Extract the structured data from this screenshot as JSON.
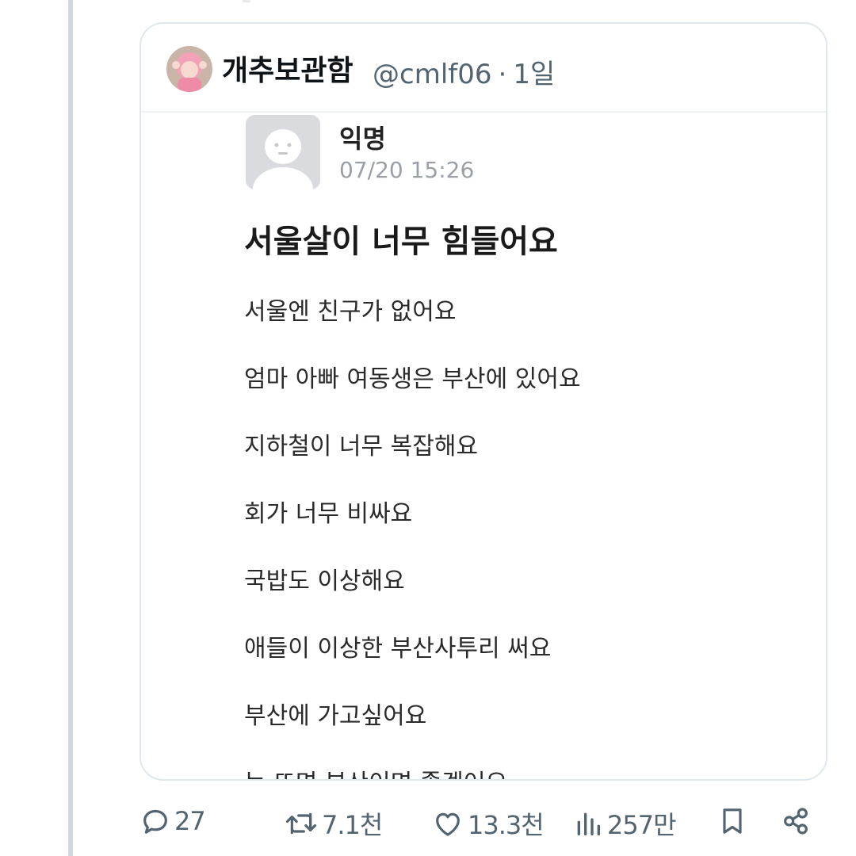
{
  "quote": {
    "display_name": "개추보관함",
    "handle": "@cmlf06",
    "separator": "·",
    "age": "1일"
  },
  "post": {
    "author": "익명",
    "timestamp": "07/20 15:26",
    "title": "서울살이 너무 힘들어요",
    "lines": [
      "서울엔 친구가 없어요",
      "엄마 아빠 여동생은 부산에 있어요",
      "지하철이 너무 복잡해요",
      "회가 너무 비싸요",
      "국밥도 이상해요",
      "애들이 이상한 부산사투리 써요",
      "부산에 가고싶어요",
      "눈 뜨면 부산이면 좋겠어요"
    ]
  },
  "actions": {
    "reply": {
      "icon": "reply-icon",
      "count": "27"
    },
    "repost": {
      "icon": "repost-icon",
      "count": "7.1천"
    },
    "like": {
      "icon": "heart-icon",
      "count": "13.3천"
    },
    "views": {
      "icon": "views-icon",
      "count": "257만"
    },
    "bookmark": {
      "icon": "bookmark-icon"
    },
    "share": {
      "icon": "share-icon"
    }
  },
  "colors": {
    "thread_line": "#cfd9de",
    "border": "#e1e8ed",
    "muted": "#536471"
  }
}
